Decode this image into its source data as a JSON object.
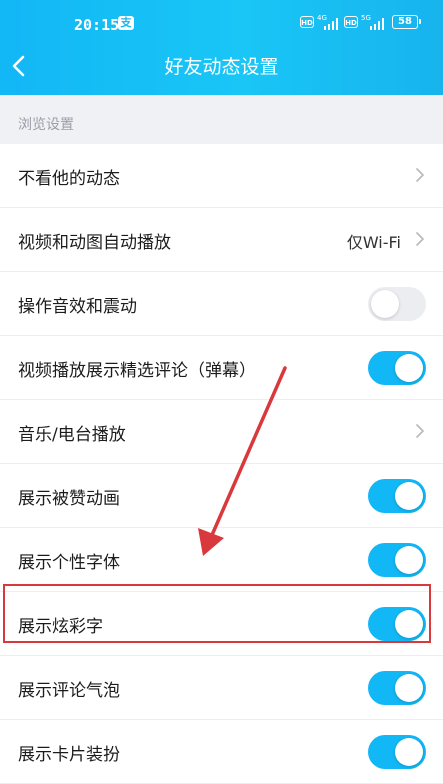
{
  "status": {
    "time": "20:15",
    "notification_badge": "支",
    "hd1": "HD",
    "net1": "4G",
    "hd2": "HD",
    "net2": "5G",
    "battery": "58"
  },
  "header": {
    "back_icon": "chevron-left-icon",
    "title": "好友动态设置"
  },
  "section": {
    "label": "浏览设置"
  },
  "rows": [
    {
      "label": "不看他的动态",
      "control": "chevron"
    },
    {
      "label": "视频和动图自动播放",
      "value": "仅Wi-Fi",
      "control": "chevron"
    },
    {
      "label": "操作音效和震动",
      "control": "toggle",
      "on": false
    },
    {
      "label": "视频播放展示精选评论（弹幕）",
      "control": "toggle",
      "on": true
    },
    {
      "label": "音乐/电台播放",
      "control": "chevron"
    },
    {
      "label": "展示被赞动画",
      "control": "toggle",
      "on": true
    },
    {
      "label": "展示个性字体",
      "control": "toggle",
      "on": true
    },
    {
      "label": "展示炫彩字",
      "control": "toggle",
      "on": true
    },
    {
      "label": "展示评论气泡",
      "control": "toggle",
      "on": true
    },
    {
      "label": "展示卡片装扮",
      "control": "toggle",
      "on": true
    }
  ],
  "colors": {
    "accent": "#12b7f5",
    "annotation": "#d9383d"
  }
}
